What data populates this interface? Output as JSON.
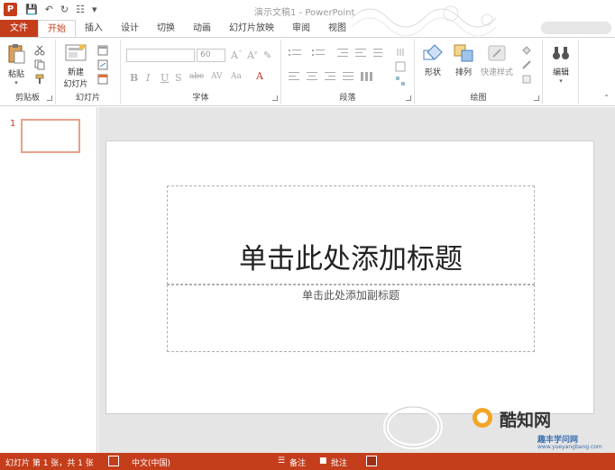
{
  "titlebar": {
    "app_icon": "P",
    "title": "演示文稿1 - PowerPoint"
  },
  "tabs": [
    {
      "label": "文件"
    },
    {
      "label": "开始"
    },
    {
      "label": "插入"
    },
    {
      "label": "设计"
    },
    {
      "label": "切换"
    },
    {
      "label": "动画"
    },
    {
      "label": "幻灯片放映"
    },
    {
      "label": "审阅"
    },
    {
      "label": "视图"
    }
  ],
  "ribbon": {
    "clipboard": {
      "paste": "粘贴",
      "label": "剪贴板"
    },
    "slides": {
      "new_slide_1": "新建",
      "new_slide_2": "幻灯片",
      "label": "幻灯片"
    },
    "font": {
      "size": "60",
      "label": "字体"
    },
    "paragraph": {
      "label": "段落"
    },
    "drawing": {
      "shapes": "形状",
      "arrange": "排列",
      "quick_styles": "快速样式",
      "label": "绘图"
    },
    "editing": {
      "edit": "编辑"
    }
  },
  "thumbnails": {
    "num": "1"
  },
  "slide": {
    "title": "单击此处添加标题",
    "subtitle": "单击此处添加副标题"
  },
  "statusbar": {
    "slide_info": "幻灯片 第 1 张，共 1 张",
    "language": "中文(中国)",
    "notes": "备注",
    "comments": "批注"
  },
  "watermark": {
    "brand": "酷知网",
    "sub": "趣丰学问网",
    "url": "www.yueyangbang.com"
  },
  "colors": {
    "accent": "#c43e1c"
  }
}
